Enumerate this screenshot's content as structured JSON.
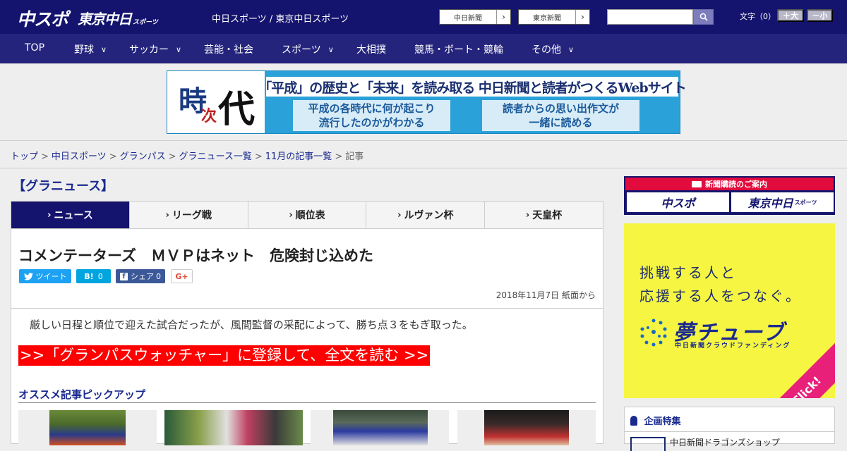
{
  "header": {
    "logo_chuspo": "中スポ",
    "logo_tokyo": "東京中日",
    "logo_tokyo_sub": "スポーツ",
    "site_name": "中日スポーツ / 東京中日スポーツ",
    "link_chunichi": "中日新聞",
    "link_tokyo": "東京新聞",
    "font_label": "文字（0）",
    "font_plus": "＋大",
    "font_minus": "－小",
    "search_placeholder": ""
  },
  "nav": {
    "items": [
      {
        "label": "TOP",
        "dropdown": false
      },
      {
        "label": "野球",
        "dropdown": true
      },
      {
        "label": "サッカー",
        "dropdown": true
      },
      {
        "label": "芸能・社会",
        "dropdown": false
      },
      {
        "label": "スポーツ",
        "dropdown": true
      },
      {
        "label": "大相撲",
        "dropdown": false
      },
      {
        "label": "競馬・ボート・競輪",
        "dropdown": false
      },
      {
        "label": "その他",
        "dropdown": true
      }
    ]
  },
  "banner": {
    "k1": "時",
    "k2": "次",
    "k3": "代",
    "headline": "「平成」の歴史と「未来」を読み取る  中日新聞と読者がつくるWebサイト",
    "box_left_1": "平成の各時代に何が起こり",
    "box_left_2": "流行したのかがわかる",
    "box_right_1": "読者からの思い出作文が",
    "box_right_2": "一緒に読める"
  },
  "breadcrumb": {
    "items": [
      "トップ",
      "中日スポーツ",
      "グランパス",
      "グラニュース一覧",
      "11月の記事一覧"
    ],
    "current": "記事",
    "sep": ">"
  },
  "section": {
    "title": "【グラニュース】"
  },
  "tabs": [
    {
      "label": "ニュース",
      "active": true
    },
    {
      "label": "リーグ戦",
      "active": false
    },
    {
      "label": "順位表",
      "active": false
    },
    {
      "label": "ルヴァン杯",
      "active": false
    },
    {
      "label": "天皇杯",
      "active": false
    }
  ],
  "article": {
    "headline": "コメンテーターズ　ＭＶＰはネット　危険封じ込めた",
    "social": {
      "tweet": "ツイート",
      "hatena": "0",
      "fb": "シェア",
      "fb_count": "0",
      "gplus": "G+"
    },
    "dateline": "2018年11月7日 紙面から",
    "lead": "厳しい日程と順位で迎えた試合だったが、風間監督の采配によって、勝ち点３をもぎ取った。",
    "cta": ">>「グランパスウォッチャー」に登録して、全文を読む >>",
    "pickup_title": "オススメ記事ピックアップ"
  },
  "sidebar": {
    "subscribe_head": "新聞購読のご案内",
    "subscribe_btn1": "中スポ",
    "subscribe_btn2": "東京中日",
    "subscribe_btn2_sub": "スポーツ",
    "ad_line1": "挑戦する人と",
    "ad_line2": "応援する人をつなぐ。",
    "ad_brand": "夢チューブ",
    "ad_brand_sub": "中日新聞クラウドファンディング",
    "ad_click": "Click!",
    "feature_head": "企画特集",
    "feature_item": "中日新聞ドラゴンズショップ"
  },
  "colors": {
    "header_bg": "#14146e",
    "nav_bg": "#24247d",
    "accent_red": "#ff0000",
    "link_blue": "#1a2a8f",
    "ad_yellow": "#f5f542"
  }
}
